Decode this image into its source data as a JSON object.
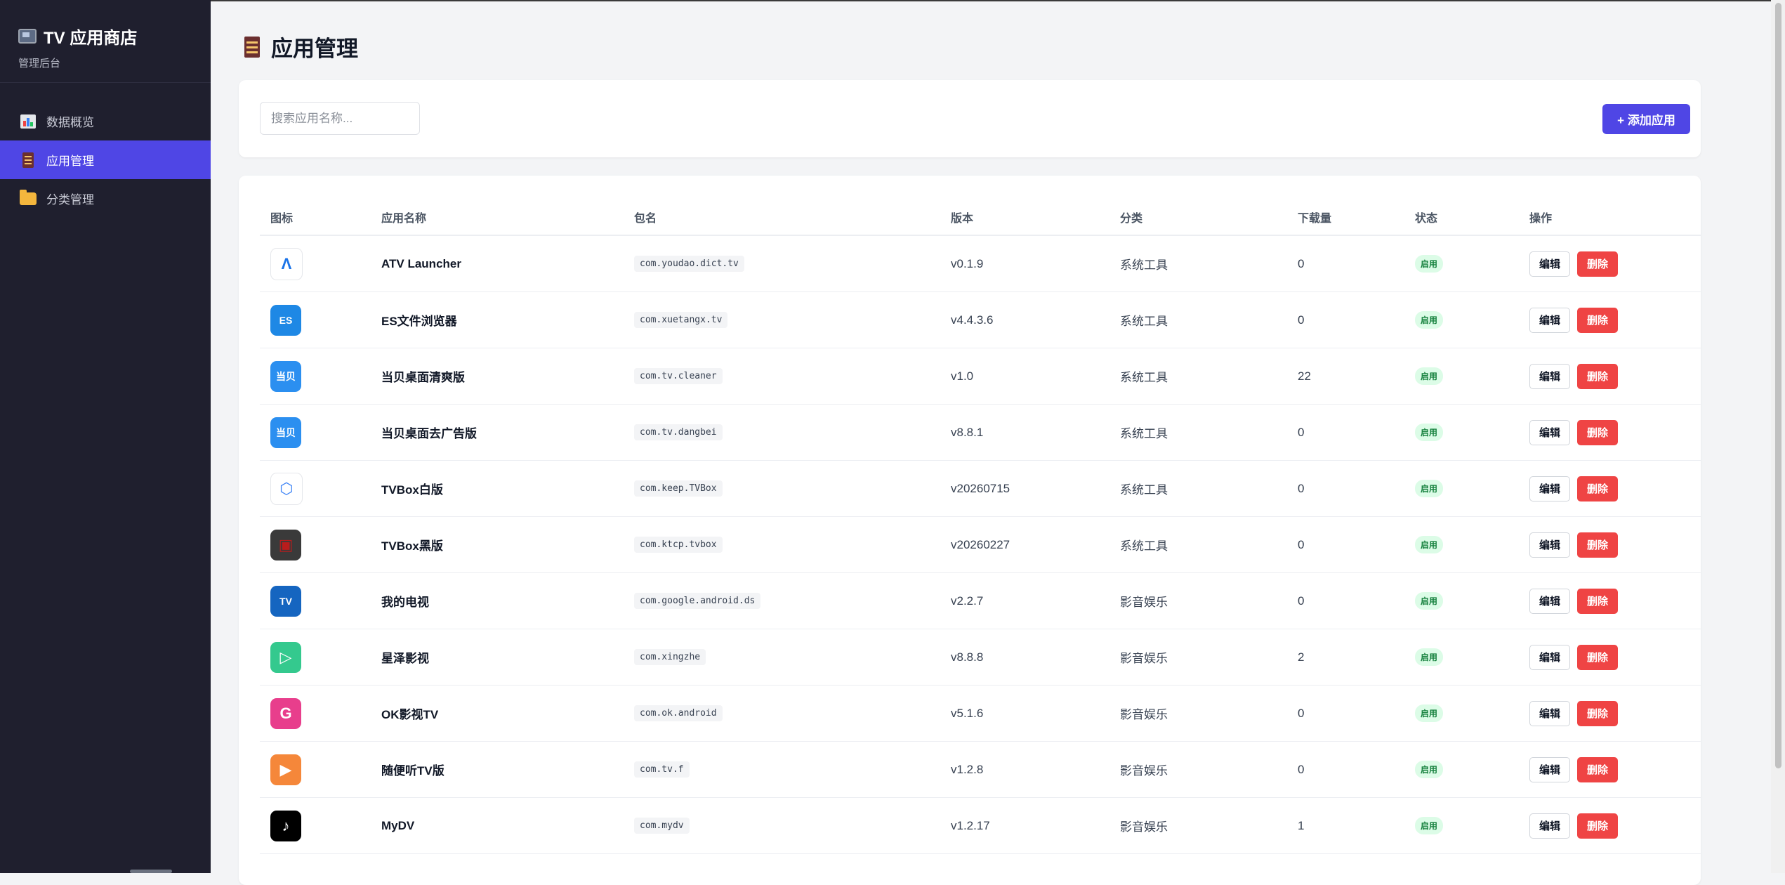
{
  "brand": {
    "title": "TV 应用商店",
    "subtitle": "管理后台"
  },
  "sidebar": {
    "items": [
      {
        "label": "数据概览",
        "icon": "bar-chart-icon",
        "active": false
      },
      {
        "label": "应用管理",
        "icon": "abacus-icon",
        "active": true
      },
      {
        "label": "分类管理",
        "icon": "folder-icon",
        "active": false
      }
    ]
  },
  "page": {
    "title": "应用管理"
  },
  "toolbar": {
    "search_placeholder": "搜索应用名称...",
    "add_label": "+ 添加应用"
  },
  "table": {
    "headers": [
      "图标",
      "应用名称",
      "包名",
      "版本",
      "分类",
      "下载量",
      "状态",
      "操作"
    ],
    "edit_label": "编辑",
    "delete_label": "删除",
    "rows": [
      {
        "icon": "atv-launcher-icon",
        "icon_bg": "#ffffff",
        "icon_fg": "#1a73e8",
        "glyph": "Λ",
        "name": "ATV Launcher",
        "package": "com.youdao.dict.tv",
        "version": "v0.1.9",
        "category": "系统工具",
        "downloads": "0",
        "status": "启用"
      },
      {
        "icon": "es-file-icon",
        "icon_bg": "#1e88e5",
        "icon_fg": "#ffffff",
        "glyph": "ES",
        "name": "ES文件浏览器",
        "package": "com.xuetangx.tv",
        "version": "v4.4.3.6",
        "category": "系统工具",
        "downloads": "0",
        "status": "启用"
      },
      {
        "icon": "dangbei-icon",
        "icon_bg": "#2b8ff0",
        "icon_fg": "#ffffff",
        "glyph": "当贝",
        "name": "当贝桌面清爽版",
        "package": "com.tv.cleaner",
        "version": "v1.0",
        "category": "系统工具",
        "downloads": "22",
        "status": "启用"
      },
      {
        "icon": "dangbei-icon",
        "icon_bg": "#2b8ff0",
        "icon_fg": "#ffffff",
        "glyph": "当贝",
        "name": "当贝桌面去广告版",
        "package": "com.tv.dangbei",
        "version": "v8.8.1",
        "category": "系统工具",
        "downloads": "0",
        "status": "启用"
      },
      {
        "icon": "tvbox-white-icon",
        "icon_bg": "#ffffff",
        "icon_fg": "#3b82f6",
        "glyph": "⬡",
        "name": "TVBox白版",
        "package": "com.keep.TVBox",
        "version": "v20260715",
        "category": "系统工具",
        "downloads": "0",
        "status": "启用"
      },
      {
        "icon": "tvbox-black-icon",
        "icon_bg": "#3a3a3a",
        "icon_fg": "#b91c1c",
        "glyph": "▣",
        "name": "TVBox黑版",
        "package": "com.ktcp.tvbox",
        "version": "v20260227",
        "category": "系统工具",
        "downloads": "0",
        "status": "启用"
      },
      {
        "icon": "my-tv-icon",
        "icon_bg": "#1565c0",
        "icon_fg": "#ffffff",
        "glyph": "TV",
        "name": "我的电视",
        "package": "com.google.android.ds",
        "version": "v2.2.7",
        "category": "影音娱乐",
        "downloads": "0",
        "status": "启用"
      },
      {
        "icon": "xingze-play-icon",
        "icon_bg": "#34c98e",
        "icon_fg": "#ffffff",
        "glyph": "▷",
        "name": "星泽影视",
        "package": "com.xingzhe",
        "version": "v8.8.8",
        "category": "影音娱乐",
        "downloads": "2",
        "status": "启用"
      },
      {
        "icon": "ok-tv-icon",
        "icon_bg": "#e83e8c",
        "icon_fg": "#ffffff",
        "glyph": "G",
        "name": "OK影视TV",
        "package": "com.ok.android",
        "version": "v5.1.6",
        "category": "影音娱乐",
        "downloads": "0",
        "status": "启用"
      },
      {
        "icon": "suibianting-icon",
        "icon_bg": "#f5873a",
        "icon_fg": "#ffffff",
        "glyph": "▶",
        "name": "随便听TV版",
        "package": "com.tv.f",
        "version": "v1.2.8",
        "category": "影音娱乐",
        "downloads": "0",
        "status": "启用"
      },
      {
        "icon": "tiktok-icon",
        "icon_bg": "#000000",
        "icon_fg": "#ffffff",
        "glyph": "♪",
        "name": "MyDV",
        "package": "com.mydv",
        "version": "v1.2.17",
        "category": "影音娱乐",
        "downloads": "1",
        "status": "启用"
      }
    ]
  }
}
